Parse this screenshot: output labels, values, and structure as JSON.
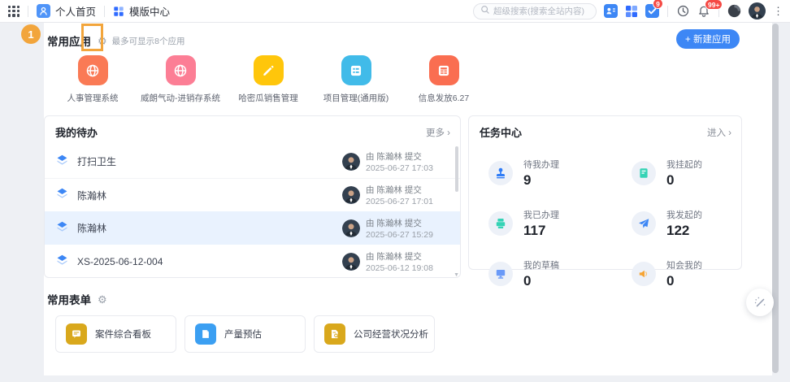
{
  "topbar": {
    "tabs": [
      {
        "label": "个人首页",
        "icon": "person-tab-icon",
        "active": true
      },
      {
        "label": "模版中心",
        "icon": "template-tab-icon",
        "active": false
      }
    ],
    "search": {
      "placeholder": "超级搜索(搜索全站内容)",
      "icon": "search-icon"
    },
    "badges": {
      "todo": "9",
      "notifications": "99+"
    },
    "icons": [
      "waffle-menu-icon",
      "contacts-icon",
      "apps-icon",
      "task-check-icon",
      "clock-icon",
      "bell-icon",
      "mascot-icon",
      "user-avatar",
      "kebab-menu-icon"
    ]
  },
  "annotations": {
    "step_number": "1",
    "highlight_color": "#F2A53C",
    "target": "apps-settings-gear"
  },
  "apps_section": {
    "title": "常用应用",
    "settings_icon": "gear-icon",
    "hint": "最多可显示8个应用",
    "new_app_label": "+ 新建应用",
    "apps": [
      {
        "name": "人事管理系统",
        "color": "#FA7A55",
        "icon": "globe-icon"
      },
      {
        "name": "威朗气动-进销存系统",
        "color": "#FC7E95",
        "icon": "globe-icon"
      },
      {
        "name": "哈密瓜销售管理",
        "color": "#FFC60B",
        "icon": "pencil-icon"
      },
      {
        "name": "项目管理(通用版)",
        "color": "#41BBE9",
        "icon": "list-icon"
      },
      {
        "name": "信息发放6.27",
        "color": "#FA6E51",
        "icon": "table-icon"
      }
    ]
  },
  "todo_panel": {
    "title": "我的待办",
    "more_label": "更多 ›",
    "items": [
      {
        "title": "打扫卫生",
        "submitter": "由 陈瀚林 提交",
        "time": "2025-06-27 17:03",
        "highlight": false
      },
      {
        "title": "陈瀚林",
        "submitter": "由 陈瀚林 提交",
        "time": "2025-06-27 17:01",
        "highlight": false
      },
      {
        "title": "陈瀚林",
        "submitter": "由 陈瀚林 提交",
        "time": "2025-06-27 15:29",
        "highlight": true
      },
      {
        "title": "XS-2025-06-12-004",
        "submitter": "由 陈瀚林 提交",
        "time": "2025-06-12 19:08",
        "highlight": false
      }
    ]
  },
  "task_panel": {
    "title": "任务中心",
    "enter_label": "进入 ›",
    "stats": [
      {
        "label": "待我办理",
        "value": "9",
        "icon": "stamp-icon",
        "color": "#2F7CF6"
      },
      {
        "label": "我挂起的",
        "value": "0",
        "icon": "notebook-icon",
        "color": "#35D3B5"
      },
      {
        "label": "我已办理",
        "value": "117",
        "icon": "printer-icon",
        "color": "#35D3B5"
      },
      {
        "label": "我发起的",
        "value": "122",
        "icon": "paper-plane-icon",
        "color": "#3D87F5"
      },
      {
        "label": "我的草稿",
        "value": "0",
        "icon": "monitor-icon",
        "color": "#6A9AF8"
      },
      {
        "label": "知会我的",
        "value": "0",
        "icon": "speaker-icon",
        "color": "#F6A433"
      }
    ]
  },
  "forms_section": {
    "title": "常用表单",
    "settings_icon": "gear-icon",
    "forms": [
      {
        "name": "案件综合看板",
        "color": "#D9A81C",
        "icon": "board-icon"
      },
      {
        "name": "产量预估",
        "color": "#3B9FF2",
        "icon": "doc-icon"
      },
      {
        "name": "公司经营状况分析",
        "color": "#D9A81C",
        "icon": "doc-search-icon"
      }
    ]
  },
  "colors": {
    "accent": "#3D87F5",
    "badge": "#F54A45",
    "page_bg": "#eef0f4",
    "highlight_row": "#e9f2fe"
  }
}
